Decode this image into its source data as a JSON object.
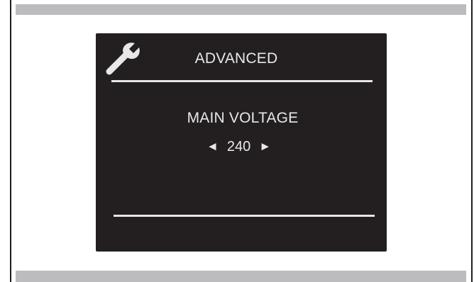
{
  "screen": {
    "icon": "wrench-icon",
    "title": "ADVANCED",
    "setting_label": "MAIN VOLTAGE",
    "value": "240",
    "left_arrow": "◄",
    "right_arrow": "►"
  },
  "colors": {
    "screen_background": "#231f20",
    "screen_text": "#e8e8e8",
    "separator_bars": "#bcbcbe"
  }
}
